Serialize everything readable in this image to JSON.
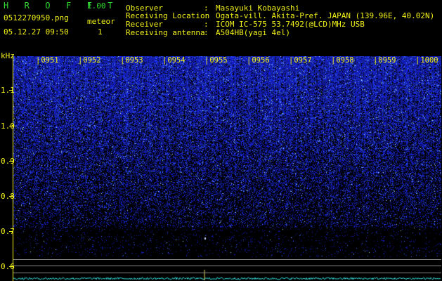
{
  "app": {
    "name": "H R O F F T",
    "version": "1.00"
  },
  "file": {
    "name": "0512270950.png",
    "datetime": "05.12.27 09:50"
  },
  "meteor": {
    "label": "meteor",
    "count": "1"
  },
  "info": [
    {
      "label": "Observer",
      "value": "Masayuki Kobayashi"
    },
    {
      "label": "Receiving Location",
      "value": "Ogata-vill. Akita-Pref. JAPAN (139.96E, 40.02N)"
    },
    {
      "label": "Receiver",
      "value": "ICOM IC-575 53.7492(@LCD)MHz USB"
    },
    {
      "label": "Receiving antenna",
      "value": "A504HB(yagi 4el)"
    }
  ],
  "colon": ":",
  "spectrogram": {
    "y_unit": "kHz",
    "y_ticks": [
      "1.1",
      "1.0",
      "0.9",
      "0.8",
      "0.7",
      "0.6"
    ],
    "time_labels": [
      "0951",
      "0952",
      "0953",
      "0954",
      "0955",
      "0956",
      "0957",
      "0958",
      "0959",
      "1000"
    ]
  },
  "colors": {
    "green_text": "#33dd33",
    "yellow_text": "#f2f21a",
    "noise_blue": "#2a3cff",
    "trace_cyan": "#33e0e0"
  }
}
